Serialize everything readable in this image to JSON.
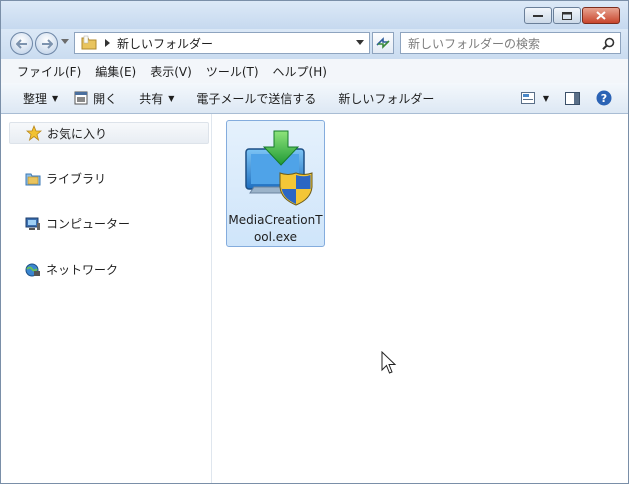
{
  "address": {
    "path": "新しいフォルダー"
  },
  "search": {
    "placeholder": "新しいフォルダーの検索"
  },
  "menu": [
    "ファイル(F)",
    "編集(E)",
    "表示(V)",
    "ツール(T)",
    "ヘルプ(H)"
  ],
  "toolbar": {
    "organize": "整理",
    "open": "開く",
    "share": "共有",
    "email": "電子メールで送信する",
    "new_folder": "新しいフォルダー"
  },
  "nav": {
    "favorites": "お気に入り",
    "libraries": "ライブラリ",
    "computer": "コンピューター",
    "network": "ネットワーク"
  },
  "file": {
    "name": "MediaCreationT\nool.exe"
  },
  "icons": [
    "back-arrow-icon",
    "forward-arrow-icon",
    "folder-icon",
    "refresh-icon",
    "search-icon",
    "star-icon",
    "library-icon",
    "computer-icon",
    "network-icon",
    "shield-icon",
    "help-icon"
  ],
  "colors": {
    "window_frame": "#c9dbef",
    "selection": "#cfe5fa",
    "close": "#c8452c"
  }
}
